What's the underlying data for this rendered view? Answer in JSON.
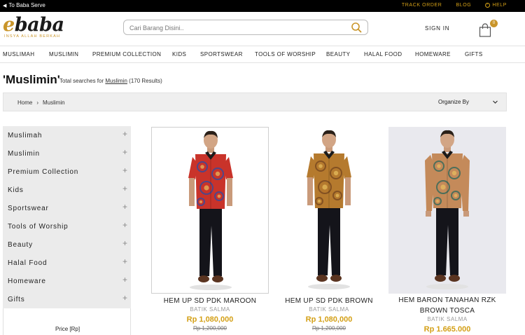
{
  "topbar": {
    "back_label": "To Baba Serve",
    "links": [
      "TRACK ORDER",
      "BLOG",
      "HELP"
    ]
  },
  "header": {
    "logo_text": "ebaba",
    "logo_tagline": "INSYA ALLAH BERKAH",
    "search_placeholder": "Cari Barang Disini..",
    "signin_label": "SIGN IN",
    "cart_count": "0"
  },
  "nav": {
    "items": [
      "MUSLIMAH",
      "MUSLIMIN",
      "PREMIUM COLLECTION",
      "KIDS",
      "SPORTSWEAR",
      "TOOLS OF WORSHIP",
      "BEAUTY",
      "HALAL FOOD",
      "HOMEWARE",
      "GIFTS"
    ]
  },
  "page": {
    "title": "'Muslimin'",
    "results_prefix": "Total searches for",
    "results_query": "Muslimin",
    "results_count": "(170 Results)"
  },
  "breadcrumb": {
    "home": "Home",
    "current": "Muslimin",
    "organize_label": "Organize By"
  },
  "sidebar": {
    "items": [
      "Muslimah",
      "Muslimin",
      "Premium Collection",
      "Kids",
      "Sportswear",
      "Tools of Worship",
      "Beauty",
      "Halal Food",
      "Homeware",
      "Gifts"
    ],
    "price_label": "Price [Rp]"
  },
  "products": [
    {
      "name": "HEM UP SD PDK MAROON",
      "brand": "BATIK SALMA",
      "price": "Rp 1,080,000",
      "old_price": "Rp 1,200,000",
      "shirt_color": "#c9332a",
      "pattern_color": "#3a4a9a"
    },
    {
      "name": "HEM UP SD PDK BROWN",
      "brand": "BATIK SALMA",
      "price": "Rp 1,080,000",
      "old_price": "Rp 1,200,000",
      "shirt_color": "#b57a2e",
      "pattern_color": "#7a4a20"
    },
    {
      "name": "HEM BARON TANAHAN RZK BROWN TOSCA",
      "brand": "BATIK SALMA",
      "price": "Rp 1.665.000",
      "old_price": "",
      "shirt_color": "#c48a5a",
      "pattern_color": "#3a6a5a"
    }
  ],
  "colors": {
    "accent": "#d4a017",
    "topbar_bg": "#000000"
  }
}
